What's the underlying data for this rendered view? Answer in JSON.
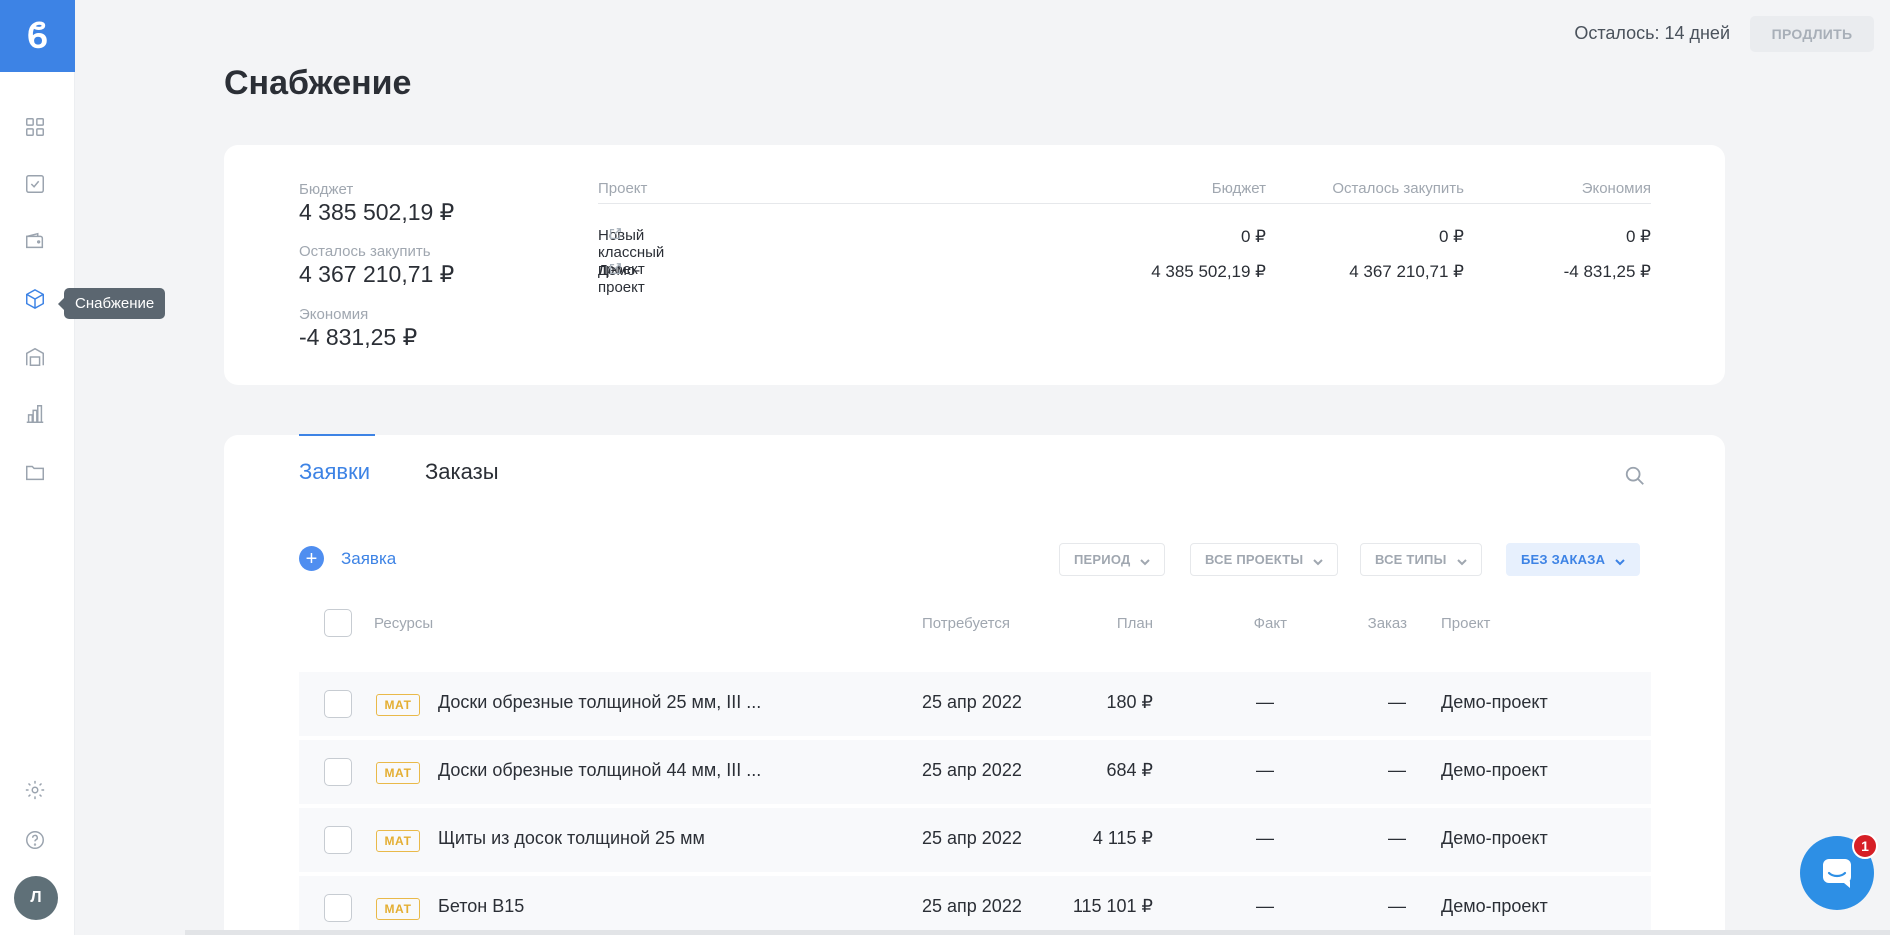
{
  "header": {
    "days_left": "Осталось: 14 дней",
    "extend_label": "ПРОДЛИТЬ",
    "page_title": "Снабжение"
  },
  "sidebar": {
    "logo": "ϐ",
    "tooltip": "Снабжение",
    "avatar_initial": "Л",
    "items": [
      {
        "icon": "dashboard-grid-icon"
      },
      {
        "icon": "tasks-checkbox-icon"
      },
      {
        "icon": "wallet-icon"
      },
      {
        "icon": "supply-box-icon",
        "active": true
      },
      {
        "icon": "warehouse-icon"
      },
      {
        "icon": "reports-chart-icon"
      },
      {
        "icon": "folder-icon"
      },
      {
        "icon": "settings-gear-icon"
      },
      {
        "icon": "help-question-icon"
      }
    ]
  },
  "summary": {
    "budget_label": "Бюджет",
    "budget_value": "4 385 502,19 ₽",
    "remaining_label": "Осталось закупить",
    "remaining_value": "4 367 210,71 ₽",
    "savings_label": "Экономия",
    "savings_value": "-4 831,25 ₽",
    "table": {
      "headers": {
        "project": "Проект",
        "budget": "Бюджет",
        "remaining": "Осталось закупить",
        "savings": "Экономия"
      },
      "rows": [
        {
          "project": "Новый классный проект",
          "budget": "0 ₽",
          "remaining": "0 ₽",
          "savings": "0 ₽"
        },
        {
          "project": "Демо-проект",
          "budget": "4 385 502,19 ₽",
          "remaining": "4 367 210,71 ₽",
          "savings": "-4 831,25 ₽"
        }
      ]
    }
  },
  "requests": {
    "tabs": [
      {
        "label": "Заявки",
        "active": true
      },
      {
        "label": "Заказы",
        "active": false
      }
    ],
    "add_label": "Заявка",
    "filters": {
      "period": "ПЕРИОД",
      "projects": "ВСЕ ПРОЕКТЫ",
      "types": "ВСЕ ТИПЫ",
      "order": "БЕЗ ЗАКАЗА"
    },
    "columns": {
      "resources": "Ресурсы",
      "required": "Потребуется",
      "plan": "План",
      "fact": "Факт",
      "order": "Заказ",
      "project": "Проект"
    },
    "rows": [
      {
        "type": "МАТ",
        "name": "Доски обрезные толщиной 25 мм, III ...",
        "required": "25 апр 2022",
        "plan": "180 ₽",
        "fact": "—",
        "order": "—",
        "project": "Демо-проект"
      },
      {
        "type": "МАТ",
        "name": "Доски обрезные толщиной 44 мм, III ...",
        "required": "25 апр 2022",
        "plan": "684 ₽",
        "fact": "—",
        "order": "—",
        "project": "Демо-проект"
      },
      {
        "type": "МАТ",
        "name": "Щиты из досок толщиной 25 мм",
        "required": "25 апр 2022",
        "plan": "4 115 ₽",
        "fact": "—",
        "order": "—",
        "project": "Демо-проект"
      },
      {
        "type": "МАТ",
        "name": "Бетон В15",
        "required": "25 апр 2022",
        "plan": "115 101 ₽",
        "fact": "—",
        "order": "—",
        "project": "Демо-проект"
      }
    ]
  },
  "chat": {
    "unread": "1"
  },
  "colors": {
    "accent": "#3d83e5",
    "badge": "#e4ae32",
    "chat": "#2d8fe5",
    "unread": "#d61f26"
  }
}
